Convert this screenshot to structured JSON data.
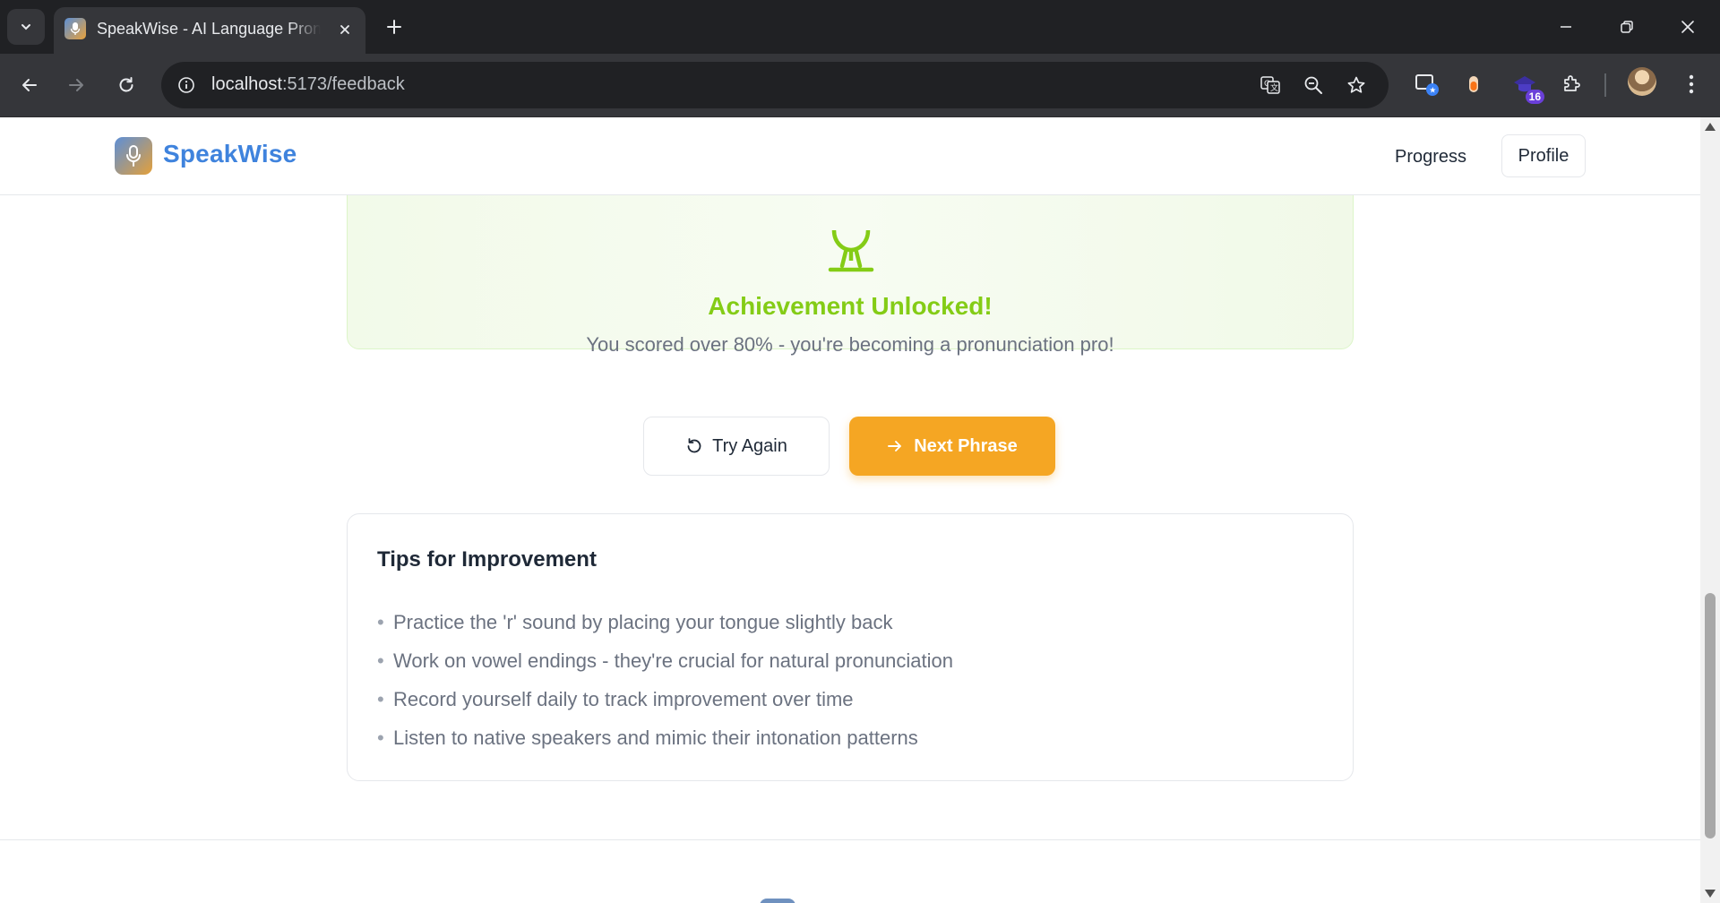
{
  "browser": {
    "tab_title": "SpeakWise - AI Language Pronunciation",
    "url_host": "localhost",
    "url_rest": ":5173/feedback",
    "extension_badge": "16"
  },
  "header": {
    "brand": "SpeakWise",
    "nav": {
      "progress": "Progress",
      "profile": "Profile"
    }
  },
  "achievement": {
    "title": "Achievement Unlocked!",
    "description": "You scored over 80% - you're becoming a pronunciation pro!"
  },
  "actions": {
    "try_again": "Try Again",
    "next_phrase": "Next Phrase"
  },
  "tips": {
    "title": "Tips for Improvement",
    "bullet": "•",
    "items": [
      "Practice the 'r' sound by placing your tongue slightly back",
      "Work on vowel endings - they're crucial for natural pronunciation",
      "Record yourself daily to track improvement over time",
      "Listen to native speakers and mimic their intonation patterns"
    ]
  },
  "colors": {
    "brand_blue": "#3f83dd",
    "achievement_green": "#84cc16",
    "next_button": "#f5a623"
  },
  "icons": {
    "brand": "microphone-icon",
    "achievement": "trophy-icon",
    "try_again": "rotate-ccw-icon",
    "next_phrase": "arrow-right-icon"
  }
}
